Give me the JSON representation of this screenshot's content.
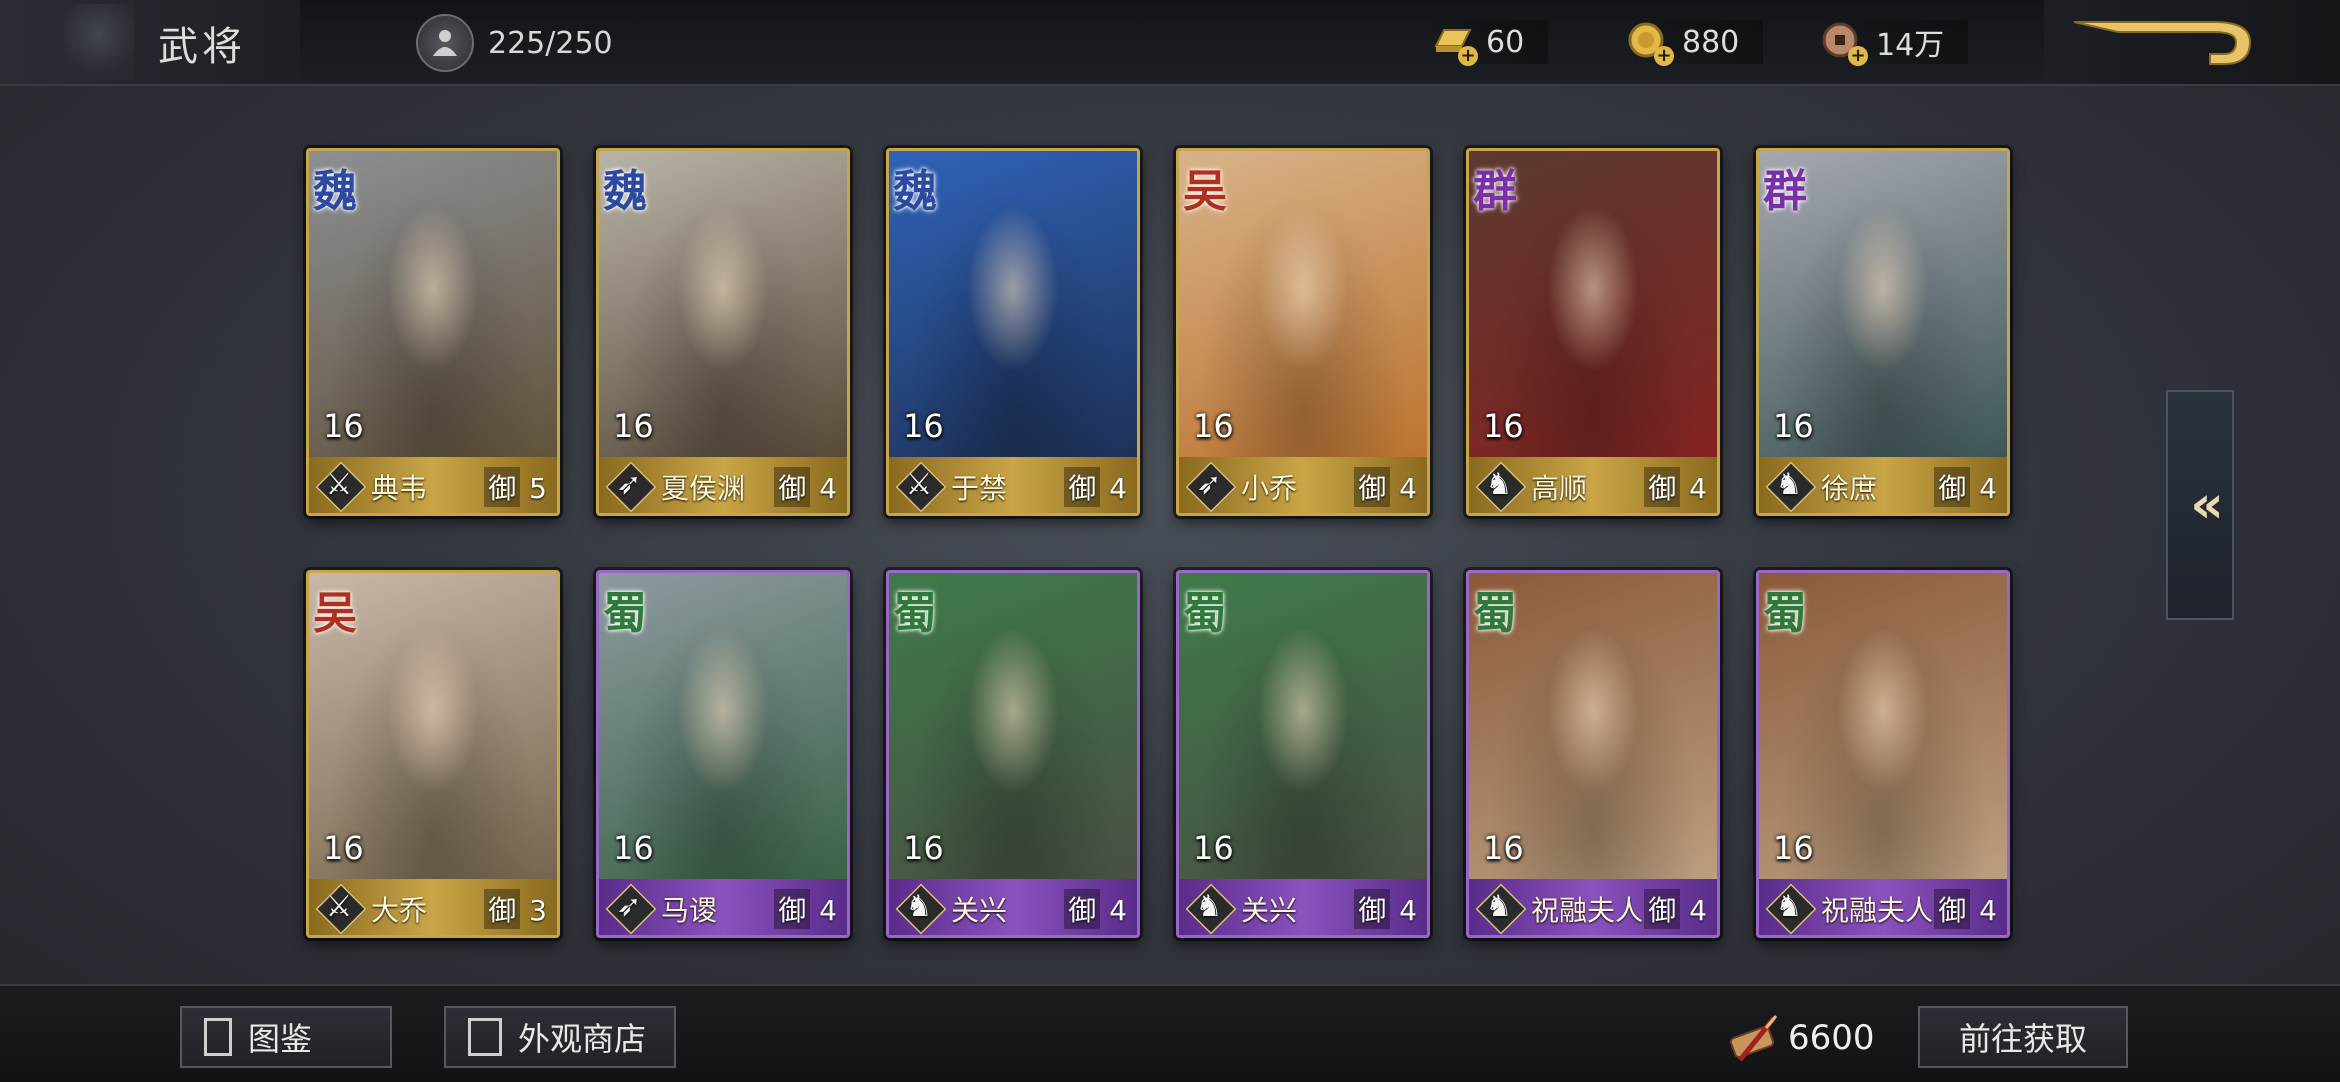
{
  "header": {
    "title": "武将",
    "stamina": "225/250",
    "resources": [
      {
        "name": "gold-bar",
        "value": "60"
      },
      {
        "name": "gold-coin",
        "value": "880"
      },
      {
        "name": "copper-coin",
        "value": "14万"
      }
    ]
  },
  "cards": [
    {
      "faction": "魏",
      "level": "16",
      "name": "典韦",
      "cost_label": "御",
      "cost": "5",
      "role": "sword-icon",
      "rarity": "gold",
      "faction_color": "#2c4aa0",
      "bg": [
        "#8d8f94",
        "#5b4a2e"
      ]
    },
    {
      "faction": "魏",
      "level": "16",
      "name": "夏侯渊",
      "cost_label": "御",
      "cost": "4",
      "role": "bow-icon",
      "rarity": "gold",
      "faction_color": "#2c4aa0",
      "bg": [
        "#b8b4a8",
        "#4a3a28"
      ]
    },
    {
      "faction": "魏",
      "level": "16",
      "name": "于禁",
      "cost_label": "御",
      "cost": "4",
      "role": "sword-icon",
      "rarity": "gold",
      "faction_color": "#2c4aa0",
      "bg": [
        "#2f63b8",
        "#1c2a4a"
      ]
    },
    {
      "faction": "吴",
      "level": "16",
      "name": "小乔",
      "cost_label": "御",
      "cost": "4",
      "role": "bow-icon",
      "rarity": "gold",
      "faction_color": "#b0301e",
      "bg": [
        "#d7b38a",
        "#b96a22"
      ]
    },
    {
      "faction": "群",
      "level": "16",
      "name": "高顺",
      "cost_label": "御",
      "cost": "4",
      "role": "horse-icon",
      "rarity": "gold",
      "faction_color": "#7a2fa8",
      "bg": [
        "#5a3a30",
        "#8a2020"
      ]
    },
    {
      "faction": "群",
      "level": "16",
      "name": "徐庶",
      "cost_label": "御",
      "cost": "4",
      "role": "horse-icon",
      "rarity": "gold",
      "faction_color": "#7a2fa8",
      "bg": [
        "#a6a8b0",
        "#2f4a4a"
      ]
    },
    {
      "faction": "吴",
      "level": "16",
      "name": "大乔",
      "cost_label": "御",
      "cost": "3",
      "role": "sword-icon",
      "rarity": "gold",
      "faction_color": "#b0301e",
      "bg": [
        "#c9b7a8",
        "#6a5a40"
      ]
    },
    {
      "faction": "蜀",
      "level": "16",
      "name": "马谡",
      "cost_label": "御",
      "cost": "4",
      "role": "bow-icon",
      "rarity": "purple",
      "faction_color": "#2f7a3a",
      "bg": [
        "#8e9aa0",
        "#2d5a3a"
      ]
    },
    {
      "faction": "蜀",
      "level": "16",
      "name": "关兴",
      "cost_label": "御",
      "cost": "4",
      "role": "horse-icon",
      "rarity": "purple",
      "faction_color": "#2f7a3a",
      "bg": [
        "#3f7a4a",
        "#4a4a42"
      ]
    },
    {
      "faction": "蜀",
      "level": "16",
      "name": "关兴",
      "cost_label": "御",
      "cost": "4",
      "role": "horse-icon",
      "rarity": "purple",
      "faction_color": "#2f7a3a",
      "bg": [
        "#3f7a4a",
        "#4a4a42"
      ]
    },
    {
      "faction": "蜀",
      "level": "16",
      "name": "祝融夫人",
      "cost_label": "御",
      "cost": "4",
      "role": "horse-icon",
      "rarity": "purple",
      "faction_color": "#2f7a3a",
      "bg": [
        "#8a5a3a",
        "#c2a88a"
      ]
    },
    {
      "faction": "蜀",
      "level": "16",
      "name": "祝融夫人",
      "cost_label": "御",
      "cost": "4",
      "role": "horse-icon",
      "rarity": "purple",
      "faction_color": "#2f7a3a",
      "bg": [
        "#8a5a3a",
        "#c2a88a"
      ]
    }
  ],
  "side_tab": {
    "label": "«"
  },
  "footer": {
    "gallery_label": "图鉴",
    "shop_label": "外观商店",
    "currency_value": "6600",
    "obtain_label": "前往获取"
  }
}
